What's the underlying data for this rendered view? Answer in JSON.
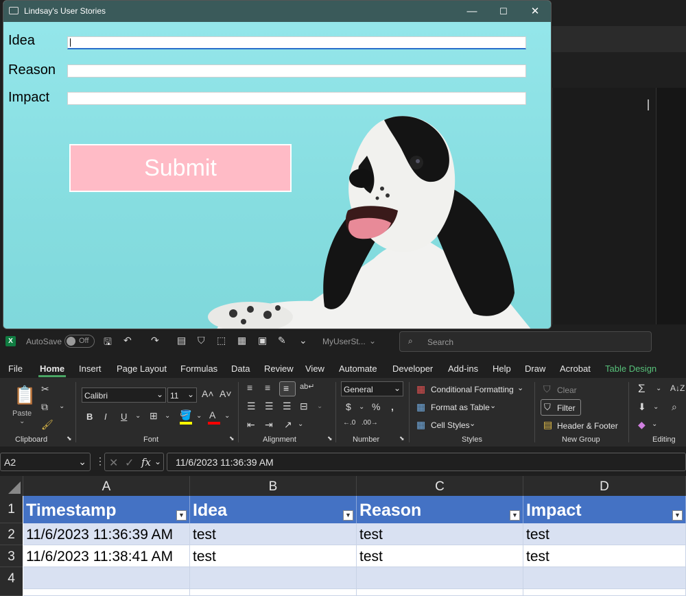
{
  "dialog": {
    "title": "Lindsay's User Stories",
    "labels": {
      "idea": "Idea",
      "reason": "Reason",
      "impact": "Impact"
    },
    "submit_label": "Submit",
    "window_buttons": {
      "minimize": "—",
      "maximize": "☐",
      "close": "✕"
    }
  },
  "excel": {
    "titlebar": {
      "autosave": "AutoSave",
      "toggle": "Off",
      "filename": "MyUserSt...",
      "search_placeholder": "Search"
    },
    "tabs": [
      "File",
      "Home",
      "Insert",
      "Page Layout",
      "Formulas",
      "Data",
      "Review",
      "View",
      "Automate",
      "Developer",
      "Add-ins",
      "Help",
      "Draw",
      "Acrobat",
      "Table Design"
    ],
    "active_tab": "Home",
    "ribbon": {
      "paste": "Paste",
      "font_name": "Calibri",
      "font_size": "11",
      "number_format": "General",
      "conditional_formatting": "Conditional Formatting",
      "format_as_table": "Format as Table",
      "cell_styles": "Cell Styles",
      "clear": "Clear",
      "filter": "Filter",
      "header_footer": "Header & Footer",
      "groups": {
        "clipboard": "Clipboard",
        "font": "Font",
        "alignment": "Alignment",
        "number": "Number",
        "styles": "Styles",
        "new_group": "New Group",
        "editing": "Editing"
      }
    },
    "name_box": "A2",
    "formula": "11/6/2023 11:36:39 AM",
    "columns": [
      "A",
      "B",
      "C",
      "D"
    ],
    "rows": [
      "1",
      "2",
      "3",
      "4"
    ],
    "headers": [
      "Timestamp",
      "Idea",
      "Reason",
      "Impact"
    ],
    "data": [
      [
        "11/6/2023 11:36:39 AM",
        "test",
        "test",
        "test"
      ],
      [
        "11/6/2023 11:38:41 AM",
        "test",
        "test",
        "test"
      ]
    ]
  }
}
